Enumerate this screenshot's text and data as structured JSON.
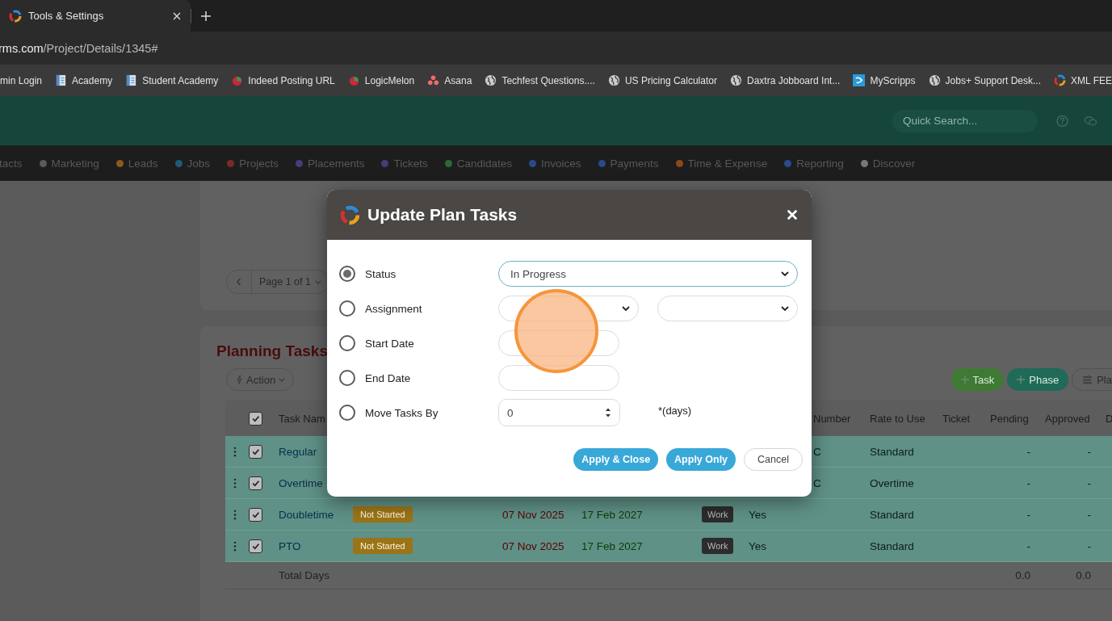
{
  "browser": {
    "tab": {
      "title": "Tools & Settings"
    },
    "address": {
      "host": "rms.com",
      "path": "/Project/Details/1345#"
    }
  },
  "bookmarks": [
    {
      "label": "min Login"
    },
    {
      "label": "Academy",
      "kind": "page"
    },
    {
      "label": "Student Academy",
      "kind": "page"
    },
    {
      "label": "Indeed Posting URL",
      "kind": "fruit"
    },
    {
      "label": "LogicMelon",
      "kind": "fruit"
    },
    {
      "label": "Asana",
      "kind": "dots"
    },
    {
      "label": "Techfest Questions....",
      "kind": "globe"
    },
    {
      "label": "US Pricing Calculator",
      "kind": "globe"
    },
    {
      "label": "Daxtra Jobboard Int...",
      "kind": "globe"
    },
    {
      "label": "MyScripps",
      "kind": "square"
    },
    {
      "label": "Jobs+ Support Desk...",
      "kind": "globe"
    },
    {
      "label": "XML FEE",
      "kind": "ring"
    }
  ],
  "header": {
    "search": {
      "placeholder": "Quick Search..."
    }
  },
  "nav": [
    {
      "label": "tacts"
    },
    {
      "label": "Marketing",
      "color": "#5a5a5a"
    },
    {
      "label": "Leads",
      "color": "#8a5a1a"
    },
    {
      "label": "Jobs",
      "color": "#1f5a7a"
    },
    {
      "label": "Projects",
      "color": "#7a2a2a"
    },
    {
      "label": "Placements",
      "color": "#4a3a7a"
    },
    {
      "label": "Tickets",
      "color": "#4a3a7a"
    },
    {
      "label": "Candidates",
      "color": "#2a6a3a"
    },
    {
      "label": "Invoices",
      "color": "#2a4a8a"
    },
    {
      "label": "Payments",
      "color": "#2a4a8a"
    },
    {
      "label": "Time & Expense",
      "color": "#8a4a1a"
    },
    {
      "label": "Reporting",
      "color": "#2a4a8a"
    },
    {
      "label": "Discover",
      "color": "#777777"
    }
  ],
  "pager": {
    "label": "Page 1 of 1"
  },
  "planning": {
    "title": "Planning Tasks",
    "action": "Action",
    "buttons": [
      {
        "label": "Task",
        "kind": "task"
      },
      {
        "label": "Phase",
        "kind": "phase"
      },
      {
        "label": "Pla",
        "kind": "options"
      }
    ],
    "table": {
      "header_checked": true,
      "headers": {
        "task_name": "Task Nam",
        "number": "Number",
        "rate": "Rate to Use",
        "ticket": "Ticket",
        "pending": "Pending",
        "approved": "Approved",
        "column_14": "D"
      },
      "rows": [
        {
          "checked": true,
          "name": "Regular",
          "number": "C",
          "rate": "Standard",
          "pending": "-",
          "approved": "-"
        },
        {
          "checked": true,
          "name": "Overtime",
          "number": "C",
          "rate": "Overtime",
          "pending": "-",
          "approved": "-"
        },
        {
          "checked": true,
          "name": "Doubletime",
          "status": "Not Started",
          "start": "07 Nov 2025",
          "end": "17 Feb 2027",
          "type": "Work",
          "billable": "Yes",
          "rate": "Standard",
          "pending": "-",
          "approved": "-"
        },
        {
          "checked": true,
          "name": "PTO",
          "status": "Not Started",
          "start": "07 Nov 2025",
          "end": "17 Feb 2027",
          "type": "Work",
          "billable": "Yes",
          "rate": "Standard",
          "pending": "-",
          "approved": "-"
        }
      ],
      "total": {
        "label": "Total Days",
        "pending": "0.0",
        "approved": "0.0"
      }
    }
  },
  "modal": {
    "title": "Update Plan Tasks",
    "options": [
      {
        "label": "Status",
        "selected": true,
        "kind": "select",
        "value": "In Progress"
      },
      {
        "label": "Assignment",
        "selected": false,
        "kind": "double_select"
      },
      {
        "label": "Start Date",
        "selected": false,
        "kind": "text"
      },
      {
        "label": "End Date",
        "selected": false,
        "kind": "text"
      },
      {
        "label": "Move Tasks By",
        "selected": false,
        "kind": "number",
        "value": "0",
        "unit": "*(days)"
      }
    ],
    "buttons": [
      {
        "label": "Apply & Close",
        "kind": "primary"
      },
      {
        "label": "Apply Only",
        "kind": "primary"
      },
      {
        "label": "Cancel",
        "kind": "secondary"
      }
    ]
  }
}
